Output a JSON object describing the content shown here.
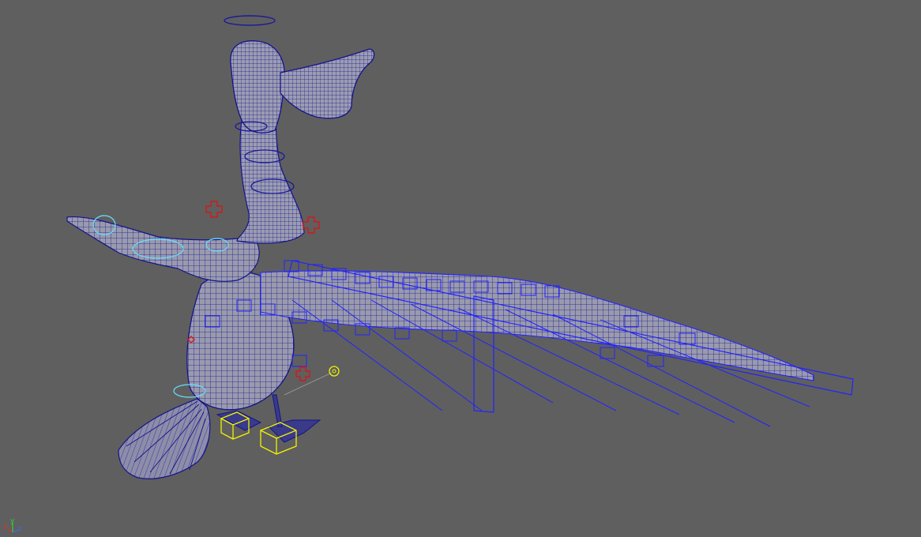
{
  "viewport": {
    "background": "#5f5f5f",
    "mesh_fill": "#9c9cb0",
    "wireframe_color": "#1a1a9a",
    "selected_wire_color": "#2323ff",
    "control_curve_color": "#1a1a9a",
    "selected_curve_color": "#66e0ff",
    "locator_color": "#d11a1a",
    "foot_control_color": "#f2f200"
  },
  "axis_gizmo": {
    "x_label": "x",
    "y_label": "y",
    "z_label": "z",
    "x_color": "#e03030",
    "y_color": "#30d030",
    "z_color": "#3a6cff"
  }
}
